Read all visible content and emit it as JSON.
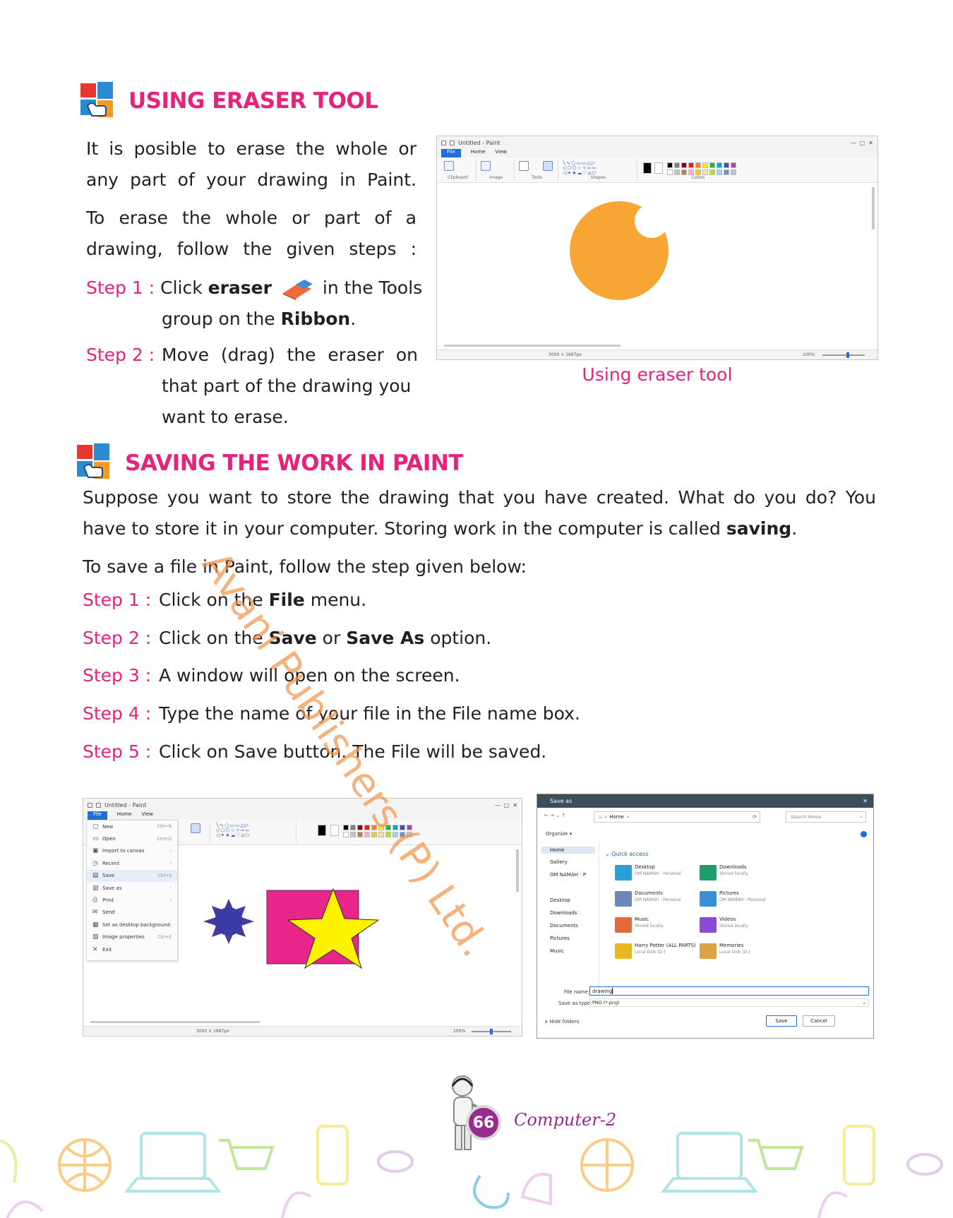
{
  "section1": {
    "heading": "USING ERASER TOOL",
    "para1": "It is posible to erase the whole or any part of your drawing in Paint.",
    "para2": "To erase the whole or part of a drawing, follow the given steps :",
    "step1": {
      "label": "Step 1 :",
      "pre": "Click ",
      "bold1": "eraser",
      "mid": " in the Tools",
      "line2pre": "group on the ",
      "bold2": "Ribbon",
      "end": "."
    },
    "step2": {
      "label": "Step 2 :",
      "line1": "Move (drag) the eraser on",
      "line2": "that part of the drawing you",
      "line3": "want to erase."
    },
    "figure_caption": "Using eraser tool"
  },
  "section2": {
    "heading": "SAVING THE WORK IN PAINT",
    "para1_line1": "Suppose you want to store the drawing that you have created. What do you do? You",
    "para1_line2_pre": "have to store it in your computer. Storing work in the computer is called ",
    "para1_bold": "saving",
    "para1_end": ".",
    "para2": "To save a file in Paint, follow the step given below:",
    "steps": [
      {
        "label": "Step 1  :",
        "pre": "Click on the ",
        "b1": "File",
        "mid": " menu.",
        "b2": "",
        "end": ""
      },
      {
        "label": "Step 2  :",
        "pre": "Click on the ",
        "b1": "Save",
        "mid": " or ",
        "b2": "Save As",
        "end": " option."
      },
      {
        "label": "Step 3  :",
        "pre": "A window will open on the screen.",
        "b1": "",
        "mid": "",
        "b2": "",
        "end": ""
      },
      {
        "label": "Step 4  :",
        "pre": "Type the name of your file in the File name box.",
        "b1": "",
        "mid": "",
        "b2": "",
        "end": ""
      },
      {
        "label": "Step 5  :",
        "pre": "Click on Save button. The File will  be saved.",
        "b1": "",
        "mid": "",
        "b2": "",
        "end": ""
      }
    ]
  },
  "paint1": {
    "title": "Untitled - Paint",
    "tabs": [
      "File",
      "Home",
      "View"
    ],
    "groups": [
      "Clipboard",
      "Image",
      "Tools",
      "Shapes",
      "Colors"
    ],
    "status_size": "3000 × 1687px",
    "zoom": "100%",
    "colors": [
      "#000000",
      "#7f7f7f",
      "#880015",
      "#ed1c24",
      "#ff7f27",
      "#fff200",
      "#22b14c",
      "#00a2e8",
      "#3f48cc",
      "#a349a4",
      "#ffffff",
      "#c3c3c3",
      "#b97a57",
      "#ffaec9",
      "#ffc90e",
      "#efe4b0",
      "#b5e61d",
      "#99d9ea",
      "#7092be",
      "#c8bfe7"
    ]
  },
  "paint2": {
    "title": "Untitled - Paint",
    "tabs": [
      "File",
      "Home",
      "View"
    ],
    "menu": [
      {
        "icon": "new-icon",
        "glyph": "▢",
        "label": "New",
        "shortcut": "Ctrl+N"
      },
      {
        "icon": "open-icon",
        "glyph": "▭",
        "label": "Open",
        "shortcut": "Ctrl+O"
      },
      {
        "icon": "import-icon",
        "glyph": "▣",
        "label": "Import to canvas",
        "shortcut": "›"
      },
      {
        "icon": "recent-icon",
        "glyph": "◷",
        "label": "Recent",
        "shortcut": "›"
      },
      {
        "icon": "save-icon",
        "glyph": "▤",
        "label": "Save",
        "shortcut": "Ctrl+S"
      },
      {
        "icon": "save-as-icon",
        "glyph": "▥",
        "label": "Save as",
        "shortcut": "›"
      },
      {
        "icon": "print-icon",
        "glyph": "⎙",
        "label": "Print",
        "shortcut": "›"
      },
      {
        "icon": "send-icon",
        "glyph": "✉",
        "label": "Send",
        "shortcut": ""
      },
      {
        "icon": "desktop-bg-icon",
        "glyph": "▦",
        "label": "Set as desktop background",
        "shortcut": "›"
      },
      {
        "icon": "properties-icon",
        "glyph": "▧",
        "label": "Image properties",
        "shortcut": "Ctrl+E"
      },
      {
        "icon": "exit-icon",
        "glyph": "✕",
        "label": "Exit",
        "shortcut": ""
      }
    ],
    "status_size": "3000 × 1687px",
    "zoom": "100%"
  },
  "save_dialog": {
    "title": "Save as",
    "breadcrumb": "Home",
    "search_placeholder": "Search Home",
    "organize": "Organize ▾",
    "quick_access": "Quick access",
    "nav": [
      "Home",
      "Gallery",
      "OM NAMAH - P",
      "Desktop",
      "Downloads",
      "Documents",
      "Pictures",
      "Music"
    ],
    "items": [
      {
        "name": "Desktop",
        "sub": "OM NAMAH - Personal",
        "color": "#2a9fd8"
      },
      {
        "name": "Downloads",
        "sub": "Stored locally",
        "color": "#1e9e6a"
      },
      {
        "name": "Documents",
        "sub": "OM NAMAH - Personal",
        "color": "#6b86b8"
      },
      {
        "name": "Pictures",
        "sub": "OM NAMAH - Personal",
        "color": "#3b8fd6"
      },
      {
        "name": "Music",
        "sub": "Stored locally",
        "color": "#e06a3c"
      },
      {
        "name": "Videos",
        "sub": "Stored locally",
        "color": "#8a4bd6"
      },
      {
        "name": "Harry Potter (ALL PARTS)",
        "sub": "Local Disk (D:)",
        "color": "#e8b820"
      },
      {
        "name": "Memories",
        "sub": "Local Disk (D:)",
        "color": "#d9a441"
      }
    ],
    "file_name_label": "File name:",
    "file_name_value": "drawing",
    "save_type_label": "Save as type:",
    "save_type_value": "PNG (*.png)",
    "hide_folders": "Hide folders",
    "save_button": "Save",
    "cancel_button": "Cancel"
  },
  "footer": {
    "page_number": "66",
    "book": "Computer-2"
  },
  "watermark": "Avani Publishers (P) Ltd."
}
